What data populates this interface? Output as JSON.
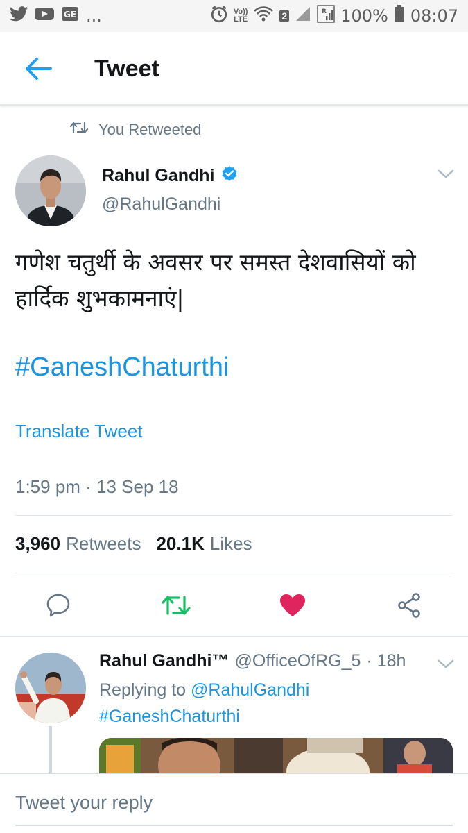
{
  "status_bar": {
    "overflow": "...",
    "sim_slot": "2",
    "battery_percent": "100%",
    "time": "08:07",
    "lte_top": "Vo))",
    "lte_bottom": "LTE",
    "left_icons": [
      "twitter-icon",
      "youtube-icon",
      "ge-icon"
    ],
    "right_icons": [
      "alarm-icon",
      "volte-icon",
      "wifi-icon",
      "signal-icon",
      "signal-r-icon",
      "battery-icon"
    ]
  },
  "header": {
    "title": "Tweet",
    "back_icon": "back-arrow-icon"
  },
  "tweet": {
    "retweet_context": "You Retweeted",
    "author_name": "Rahul Gandhi",
    "author_handle": "@RahulGandhi",
    "text": "गणेश चतुर्थी के अवसर पर समस्त देशवासियों को हार्दिक शुभकामनाएं|",
    "hashtag": "#GaneshChaturthi",
    "translate_label": "Translate Tweet",
    "timestamp": "1:59 pm · 13 Sep 18",
    "retweet_count": "3,960",
    "retweet_label": "Retweets",
    "like_count": "20.1K",
    "like_label": "Likes",
    "liked": true,
    "retweeted": true,
    "colors": {
      "link": "#1b95e0",
      "retweet_active": "#17bf63",
      "like_active": "#e0245e",
      "secondary_text": "#657786"
    }
  },
  "reply": {
    "author_name": "Rahul Gandhi™",
    "author_handle": "@OfficeOfRG_5",
    "time_ago": "· 18h",
    "replying_prefix": "Replying to",
    "replying_to": "@RahulGandhi",
    "hashtag": "#GaneshChaturthi"
  },
  "composer": {
    "placeholder": "Tweet your reply"
  }
}
